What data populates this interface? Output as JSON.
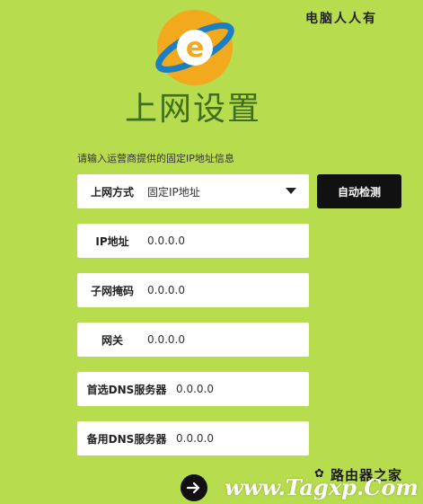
{
  "watermark_top": "电脑人人有",
  "page": {
    "title": "上网设置",
    "subtitle": "请输入运营商提供的固定IP地址信息"
  },
  "form": {
    "connection_type": {
      "label": "上网方式",
      "value": "固定IP地址"
    },
    "auto_detect_label": "自动检测",
    "ip_address": {
      "label": "IP地址",
      "value": "0.0.0.0"
    },
    "subnet_mask": {
      "label": "子网掩码",
      "value": "0.0.0.0"
    },
    "gateway": {
      "label": "网关",
      "value": "0.0.0.0"
    },
    "primary_dns": {
      "label": "首选DNS服务器",
      "value": "0.0.0.0"
    },
    "secondary_dns": {
      "label": "备用DNS服务器",
      "value": "0.0.0.0"
    }
  },
  "watermark_bottom": {
    "url": "www.Tagxp.Com",
    "name": "路由器之家"
  },
  "colors": {
    "background": "#b7dc4e",
    "title": "#3f6f1e",
    "button": "#111111",
    "logo": "#f2a91e"
  },
  "icons": {
    "logo": "ie-logo-icon",
    "dropdown": "caret-down-icon",
    "next": "arrow-right-icon"
  }
}
